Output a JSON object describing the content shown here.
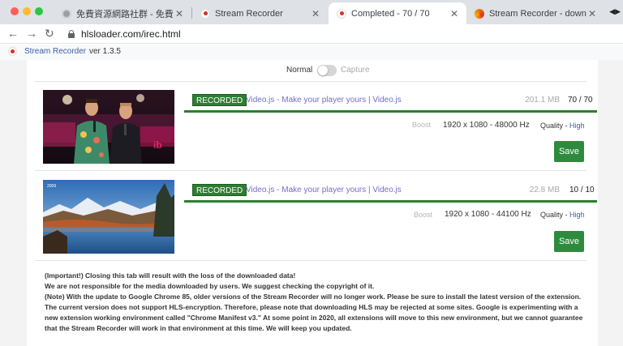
{
  "browser": {
    "tabs": [
      {
        "title": "免費資源網路社群 - 免費資源指南",
        "favicon": "globe-favicon",
        "active": false
      },
      {
        "title": "Stream Recorder",
        "favicon": "stream-recorder-favicon",
        "active": false
      },
      {
        "title": "Completed - 70 / 70",
        "favicon": "stream-recorder-favicon",
        "active": true
      },
      {
        "title": "Stream Recorder - download H",
        "favicon": "firefox-favicon",
        "active": false
      }
    ],
    "close_glyph": "✕",
    "more_glyph": "◀▶",
    "nav": {
      "back": "←",
      "forward": "→",
      "reload": "↻"
    },
    "url": "hlsloader.com/irec.html"
  },
  "app": {
    "title": "Stream Recorder",
    "version": "ver 1.3.5",
    "accent": "#3a5fa8"
  },
  "mode": {
    "normal_label": "Normal",
    "capture_label": "Capture",
    "capture_enabled": false
  },
  "recordings": [
    {
      "status": "RECORDED",
      "title": "Video.js - Make your player yours | Video.js",
      "size": "201.1 MB",
      "count": "70 / 70",
      "progress": 1.0,
      "boost_label": "Boost",
      "resolution": "1920 x 1080 - 48000 Hz",
      "quality_label": "Quality - ",
      "quality_value": "High",
      "save_label": "Save",
      "thumbnail": "two-presenters-stage"
    },
    {
      "status": "RECORDED",
      "title": "Video.js - Make your player yours | Video.js",
      "size": "22.8 MB",
      "count": "10 / 10",
      "progress": 1.0,
      "boost_label": "Boost",
      "resolution": "1920 x 1080 - 44100 Hz",
      "quality_label": "Quality - ",
      "quality_value": "High",
      "save_label": "Save",
      "thumbnail": "mountain-lake-landscape",
      "thumbnail_caption": "2009"
    }
  ],
  "notes": [
    "(Important!) Closing this tab will result with the loss of the downloaded data!",
    "We are not responsible for the media downloaded by users. We suggest checking the copyright of it.",
    "(Note) With the update to Google Chrome 85, older versions of the Stream Recorder will no longer work. Please be sure to install the latest version of the extension. The current version does not support HLS-encryption. Therefore, please note that downloading HLS may be rejected at some sites. Google is experimenting with a new extension working environment called \"Chrome Manifest v3.\" At some point in 2020, all extensions will move to this new environment, but we cannot guarantee that the Stream Recorder will work in that environment at this time. We will keep you updated."
  ],
  "colors": {
    "recorded_green": "#2e7d32",
    "save_green": "#2e8b3d",
    "link": "#6f6fc9"
  }
}
